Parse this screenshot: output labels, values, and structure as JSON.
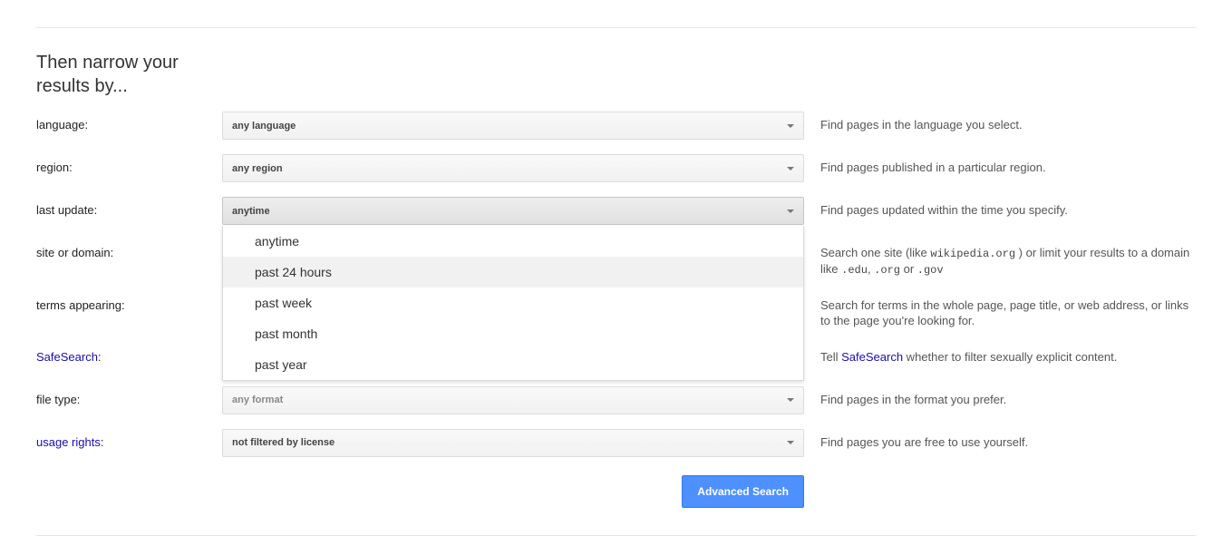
{
  "title": "Then narrow your results by...",
  "rows": {
    "language": {
      "label": "language:",
      "value": "any language",
      "hint": "Find pages in the language you select."
    },
    "region": {
      "label": "region:",
      "value": "any region",
      "hint": "Find pages published in a particular region."
    },
    "last_update": {
      "label": "last update:",
      "value": "anytime",
      "hint": "Find pages updated within the time you specify.",
      "options": [
        "anytime",
        "past 24 hours",
        "past week",
        "past month",
        "past year"
      ]
    },
    "site": {
      "label": "site or domain:",
      "hint_pre": "Search one site (like ",
      "hint_code1": "wikipedia.org",
      "hint_mid": " ) or limit your results to a domain like ",
      "hint_code2": ".edu",
      "hint_comma": ", ",
      "hint_code3": ".org",
      "hint_or": " or ",
      "hint_code4": ".gov"
    },
    "terms": {
      "label": "terms appearing:",
      "hint": "Search for terms in the whole page, page title, or web address, or links to the page you're looking for."
    },
    "safesearch": {
      "label_link": "SafeSearch",
      "label_colon": ":",
      "hint_pre": "Tell ",
      "hint_link": "SafeSearch",
      "hint_post": " whether to filter sexually explicit content."
    },
    "filetype": {
      "label": "file type:",
      "value": "any format",
      "hint": "Find pages in the format you prefer."
    },
    "usage": {
      "label_link": "usage rights",
      "label_colon": ":",
      "value": "not filtered by license",
      "hint": "Find pages you are free to use yourself."
    }
  },
  "button": "Advanced Search"
}
